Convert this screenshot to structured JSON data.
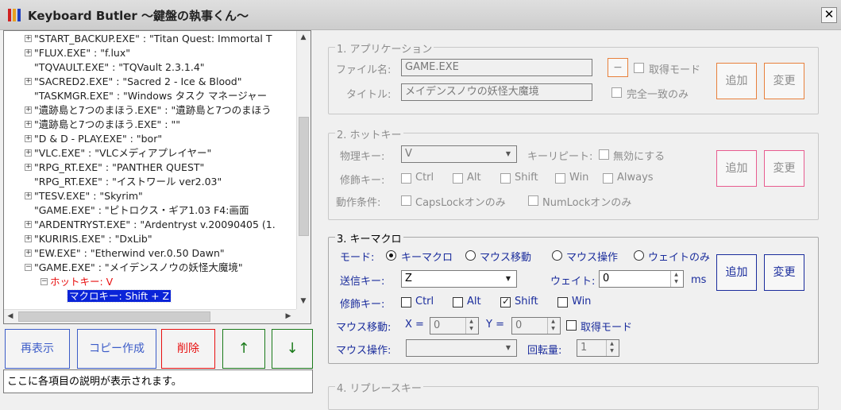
{
  "window": {
    "title": "Keyboard Butler 〜鍵盤の執事くん〜",
    "close_glyph": "✕"
  },
  "tree": {
    "items": [
      {
        "text": "\"START_BACKUP.EXE\" : \"Titan Quest: Immortal T",
        "expander": "+"
      },
      {
        "text": "\"FLUX.EXE\" : \"f.lux\"",
        "expander": "+"
      },
      {
        "text": "\"TQVAULT.EXE\" : \"TQVault 2.3.1.4\"",
        "expander": ""
      },
      {
        "text": "\"SACRED2.EXE\" : \"Sacred 2 - Ice & Blood\"",
        "expander": "+"
      },
      {
        "text": "\"TASKMGR.EXE\" : \"Windows タスク マネージャー",
        "expander": ""
      },
      {
        "text": "\"遺跡島と7つのまほう.EXE\" : \"遺跡島と7つのまほう",
        "expander": "+"
      },
      {
        "text": "\"遺跡島と7つのまほう.EXE\" : \"\"",
        "expander": "+"
      },
      {
        "text": "\"D & D - PLAY.EXE\" : \"bor\"",
        "expander": "+"
      },
      {
        "text": "\"VLC.EXE\" : \"VLCメディアプレイヤー\"",
        "expander": "+"
      },
      {
        "text": "\"RPG_RT.EXE\" : \"PANTHER QUEST\"",
        "expander": "+"
      },
      {
        "text": "\"RPG_RT.EXE\" : \"イストワール  ver2.03\"",
        "expander": ""
      },
      {
        "text": "\"TESV.EXE\" : \"Skyrim\"",
        "expander": "+"
      },
      {
        "text": "\"GAME.EXE\" : \"ピトロクス・ギア1.03          F4:画面",
        "expander": ""
      },
      {
        "text": "\"ARDENTRYST.EXE\" : \"Ardentryst v.20090405 (1.",
        "expander": "+"
      },
      {
        "text": "\"KURIRIS.EXE\" : \"DxLib\"",
        "expander": "+"
      },
      {
        "text": "\"EW.EXE\" : \"Etherwind ver.0.50 Dawn\"",
        "expander": "+"
      },
      {
        "text": "\"GAME.EXE\" : \"メイデンスノウの妖怪大魔境\"",
        "expander": "−"
      }
    ],
    "child_hotkey": "ホットキー: V",
    "child_macro": "マクロキー: Shift + Z"
  },
  "buttons": {
    "redisplay": "再表示",
    "copy": "コピー作成",
    "delete": "削除",
    "up": "↑",
    "down": "↓"
  },
  "status_text": "ここに各項目の説明が表示されます。",
  "app_group": {
    "title": "1. アプリケーション",
    "file_label": "ファイル名:",
    "file_value": "GAME.EXE",
    "title_label": "タイトル:",
    "title_value": "メイデンスノウの妖怪大魔境",
    "dash_button": "−",
    "acquire_mode": "取得モード",
    "exact_match": "完全一致のみ",
    "add": "追加",
    "change": "変更"
  },
  "hotkey_group": {
    "title": "2. ホットキー",
    "physical_label": "物理キー:",
    "physical_value": "V",
    "repeat_label": "キーリピート:",
    "disable": "無効にする",
    "modifier_label": "修飾キー:",
    "mods": [
      "Ctrl",
      "Alt",
      "Shift",
      "Win",
      "Always"
    ],
    "condition_label": "動作条件:",
    "caps": "CapsLockオンのみ",
    "num": "NumLockオンのみ",
    "add": "追加",
    "change": "変更"
  },
  "macro_group": {
    "title": "3. キーマクロ",
    "mode_label": "モード:",
    "modes": [
      "キーマクロ",
      "マウス移動",
      "マウス操作",
      "ウェイトのみ"
    ],
    "send_label": "送信キー:",
    "send_value": "Z",
    "wait_label": "ウェイト:",
    "wait_value": "0",
    "wait_unit": "ms",
    "modifier_label": "修飾キー:",
    "mods": [
      "Ctrl",
      "Alt",
      "Shift",
      "Win"
    ],
    "mouse_move_label": "マウス移動:",
    "x_label": "X =",
    "x_value": "0",
    "y_label": "Y =",
    "y_value": "0",
    "acquire_mode": "取得モード",
    "mouse_op_label": "マウス操作:",
    "rotation_label": "回転量:",
    "rotation_value": "1",
    "add": "追加",
    "change": "変更"
  },
  "replace_group": {
    "title": "4. リプレースキー"
  },
  "colors": {
    "orange": "#e8803c",
    "pink": "#e85c90",
    "navy": "#1a2c9c",
    "red": "#e81010",
    "green": "#1a7a1a",
    "blue_btn": "#3c5cc8",
    "selection": "#0a24d8"
  }
}
